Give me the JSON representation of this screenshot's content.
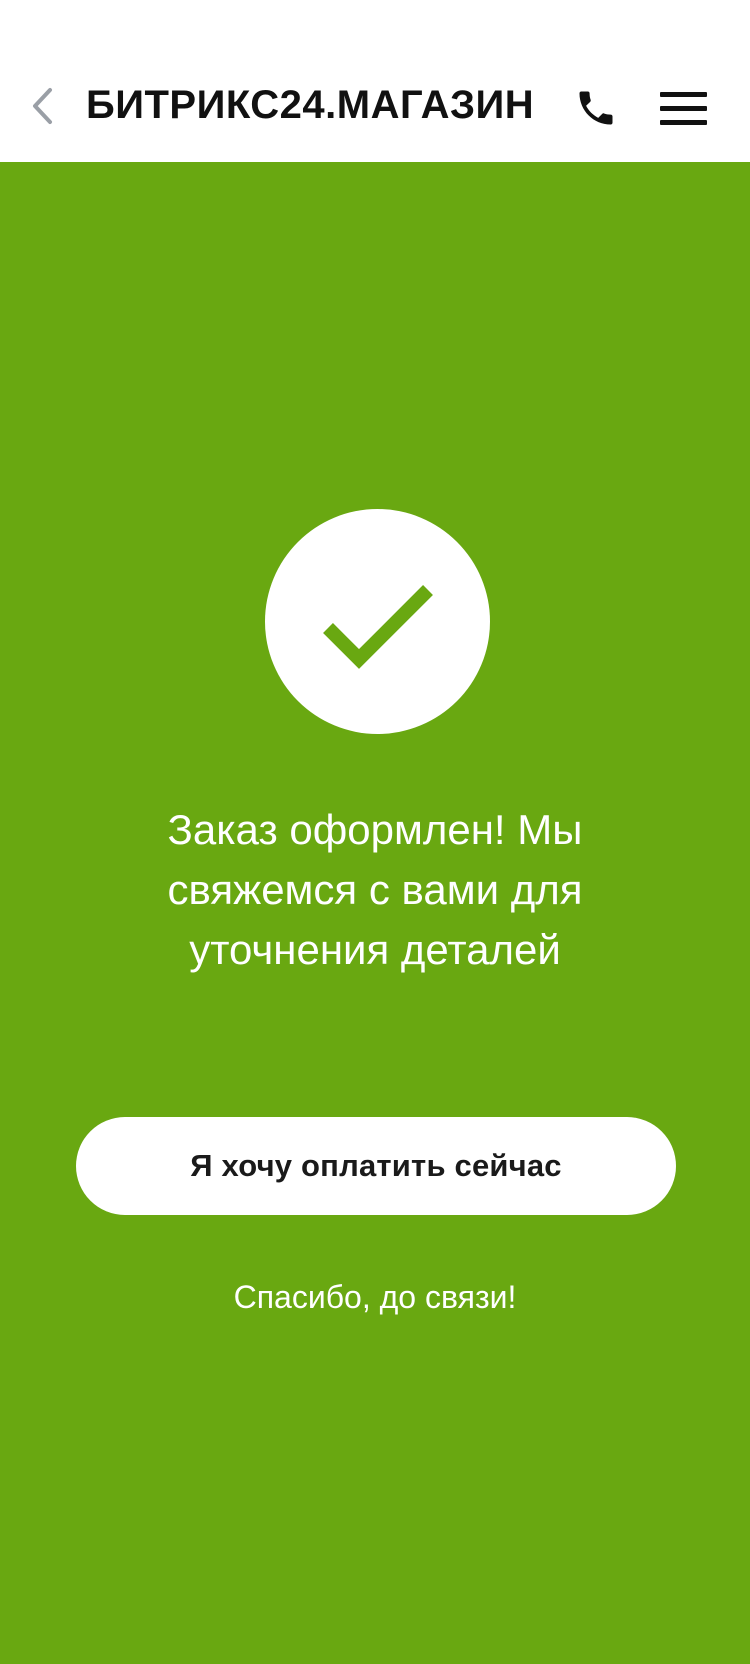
{
  "header": {
    "title": "БИТРИКС24.МАГАЗИН",
    "back_icon": "chevron-left-icon",
    "phone_icon": "phone-icon",
    "menu_icon": "hamburger-menu-icon"
  },
  "success": {
    "icon": "checkmark-icon",
    "message": "Заказ оформлен! Мы свяжемся с вами для уточнения деталей"
  },
  "actions": {
    "pay_now_label": "Я хочу оплатить сейчас",
    "thanks_label": "Спасибо, до связи!"
  },
  "colors": {
    "background": "#69a811",
    "header_bg": "#ffffff",
    "text_dark": "#111111",
    "back_chevron": "#9a9fa6"
  }
}
